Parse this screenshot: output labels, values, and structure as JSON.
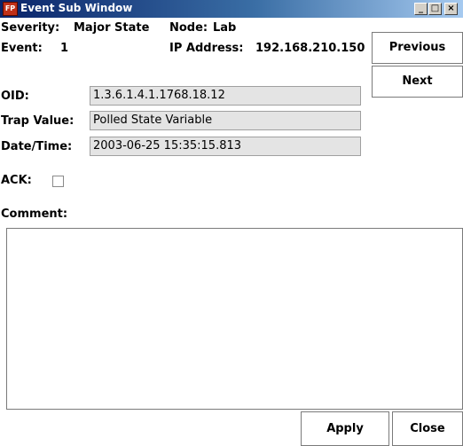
{
  "window": {
    "title": "Event Sub Window",
    "icon_text": "FP",
    "minimize": "_",
    "maximize": "□",
    "close": "×"
  },
  "summary": {
    "severity_label": "Severity:",
    "severity_value": "Major State",
    "node_label": "Node:",
    "node_value": "Lab",
    "event_label": "Event:",
    "event_value": "1",
    "ip_label": "IP Address:",
    "ip_value": "192.168.210.150"
  },
  "fields": {
    "oid_label": "OID:",
    "oid_value": "1.3.6.1.4.1.1768.18.12",
    "trap_label": "Trap Value:",
    "trap_value": "Polled State Variable",
    "datetime_label": "Date/Time:",
    "datetime_value": "2003-06-25 15:35:15.813"
  },
  "ack": {
    "label": "ACK:",
    "checked": false
  },
  "comment": {
    "label": "Comment:",
    "value": ""
  },
  "buttons": {
    "previous": "Previous",
    "next": "Next",
    "apply": "Apply",
    "close": "Close"
  }
}
